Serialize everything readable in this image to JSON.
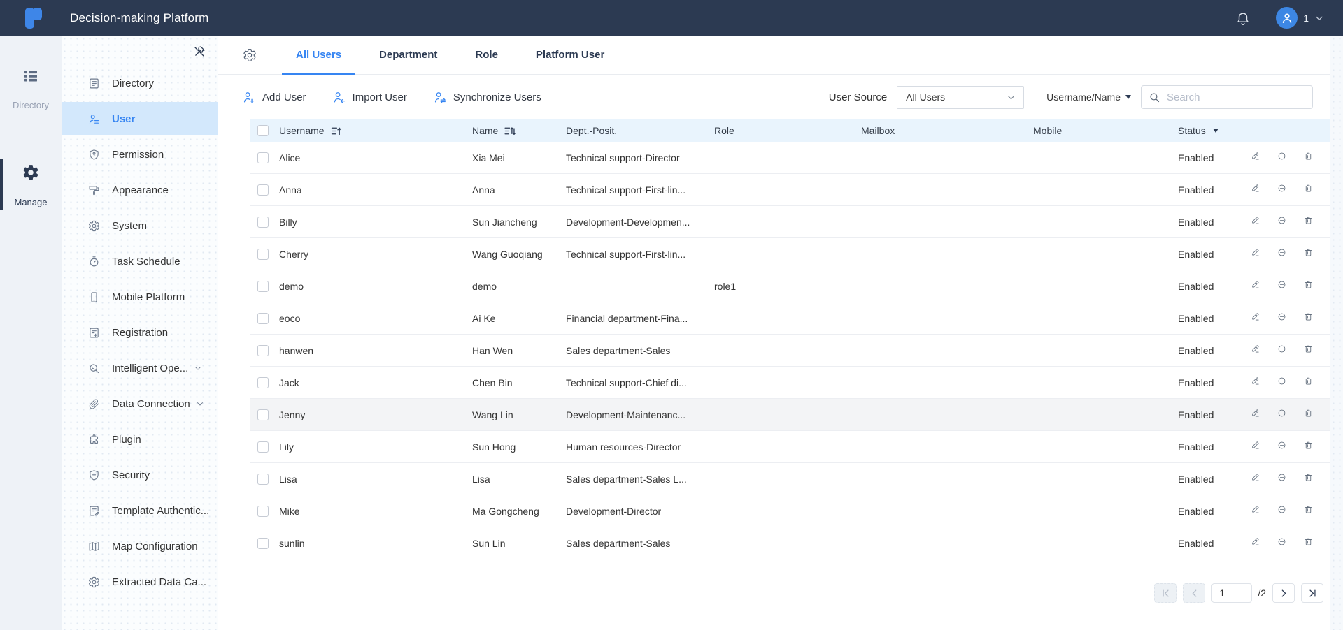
{
  "topbar": {
    "title": "Decision-making Platform",
    "notification_count": "1"
  },
  "rail": {
    "items": [
      {
        "label": "Directory",
        "icon": "directory-grid",
        "active": false
      },
      {
        "label": "Manage",
        "icon": "gear-filled",
        "active": true
      }
    ]
  },
  "sidebar": {
    "items": [
      {
        "label": "Directory",
        "icon": "directory-doc",
        "selected": false,
        "chevron": false
      },
      {
        "label": "User",
        "icon": "user-list",
        "selected": true,
        "chevron": false
      },
      {
        "label": "Permission",
        "icon": "shield-key",
        "selected": false,
        "chevron": false
      },
      {
        "label": "Appearance",
        "icon": "paint-roller",
        "selected": false,
        "chevron": false
      },
      {
        "label": "System",
        "icon": "gear-outline",
        "selected": false,
        "chevron": false
      },
      {
        "label": "Task Schedule",
        "icon": "stopwatch",
        "selected": false,
        "chevron": false
      },
      {
        "label": "Mobile Platform",
        "icon": "smartphone",
        "selected": false,
        "chevron": false
      },
      {
        "label": "Registration",
        "icon": "doc-plus",
        "selected": false,
        "chevron": false
      },
      {
        "label": "Intelligent Ope...",
        "icon": "magnifier-wrench",
        "selected": false,
        "chevron": true
      },
      {
        "label": "Data Connection",
        "icon": "paperclip",
        "selected": false,
        "chevron": true
      },
      {
        "label": "Plugin",
        "icon": "puzzle",
        "selected": false,
        "chevron": false
      },
      {
        "label": "Security",
        "icon": "shield-plus",
        "selected": false,
        "chevron": false
      },
      {
        "label": "Template Authentic...",
        "icon": "doc-pen",
        "selected": false,
        "chevron": false
      },
      {
        "label": "Map Configuration",
        "icon": "map",
        "selected": false,
        "chevron": false
      },
      {
        "label": "Extracted Data Ca...",
        "icon": "gear-outline",
        "selected": false,
        "chevron": false
      }
    ]
  },
  "tabs": [
    {
      "label": "All Users",
      "active": true
    },
    {
      "label": "Department",
      "active": false
    },
    {
      "label": "Role",
      "active": false
    },
    {
      "label": "Platform User",
      "active": false
    }
  ],
  "toolbar": {
    "actions": [
      {
        "label": "Add User",
        "icon": "add-user"
      },
      {
        "label": "Import User",
        "icon": "import-user"
      },
      {
        "label": "Synchronize Users",
        "icon": "sync-users"
      }
    ],
    "user_source_label": "User Source",
    "user_source_value": "All Users",
    "search_category": "Username/Name",
    "search_placeholder": "Search",
    "search_value": ""
  },
  "table": {
    "columns": {
      "username": "Username",
      "name": "Name",
      "dept": "Dept.-Posit.",
      "role": "Role",
      "mailbox": "Mailbox",
      "mobile": "Mobile",
      "status": "Status"
    },
    "rows": [
      {
        "username": "Alice",
        "name": "Xia Mei",
        "dept": "Technical support-Director",
        "role": "",
        "mailbox": "",
        "mobile": "",
        "status": "Enabled",
        "highlighted": false
      },
      {
        "username": "Anna",
        "name": "Anna",
        "dept": "Technical support-First-lin...",
        "role": "",
        "mailbox": "",
        "mobile": "",
        "status": "Enabled",
        "highlighted": false
      },
      {
        "username": "Billy",
        "name": "Sun Jiancheng",
        "dept": "Development-Developmen...",
        "role": "",
        "mailbox": "",
        "mobile": "",
        "status": "Enabled",
        "highlighted": false
      },
      {
        "username": "Cherry",
        "name": "Wang Guoqiang",
        "dept": "Technical support-First-lin...",
        "role": "",
        "mailbox": "",
        "mobile": "",
        "status": "Enabled",
        "highlighted": false
      },
      {
        "username": "demo",
        "name": "demo",
        "dept": "",
        "role": "role1",
        "mailbox": "",
        "mobile": "",
        "status": "Enabled",
        "highlighted": false
      },
      {
        "username": "eoco",
        "name": "Ai Ke",
        "dept": "Financial department-Fina...",
        "role": "",
        "mailbox": "",
        "mobile": "",
        "status": "Enabled",
        "highlighted": false
      },
      {
        "username": "hanwen",
        "name": "Han Wen",
        "dept": "Sales department-Sales",
        "role": "",
        "mailbox": "",
        "mobile": "",
        "status": "Enabled",
        "highlighted": false
      },
      {
        "username": "Jack",
        "name": "Chen Bin",
        "dept": "Technical support-Chief di...",
        "role": "",
        "mailbox": "",
        "mobile": "",
        "status": "Enabled",
        "highlighted": false
      },
      {
        "username": "Jenny",
        "name": "Wang Lin",
        "dept": "Development-Maintenanc...",
        "role": "",
        "mailbox": "",
        "mobile": "",
        "status": "Enabled",
        "highlighted": true
      },
      {
        "username": "Lily",
        "name": "Sun Hong",
        "dept": "Human resources-Director",
        "role": "",
        "mailbox": "",
        "mobile": "",
        "status": "Enabled",
        "highlighted": false
      },
      {
        "username": "Lisa",
        "name": "Lisa",
        "dept": "Sales department-Sales L...",
        "role": "",
        "mailbox": "",
        "mobile": "",
        "status": "Enabled",
        "highlighted": false
      },
      {
        "username": "Mike",
        "name": "Ma Gongcheng",
        "dept": "Development-Director",
        "role": "",
        "mailbox": "",
        "mobile": "",
        "status": "Enabled",
        "highlighted": false
      },
      {
        "username": "sunlin",
        "name": "Sun Lin",
        "dept": "Sales department-Sales",
        "role": "",
        "mailbox": "",
        "mobile": "",
        "status": "Enabled",
        "highlighted": false
      }
    ]
  },
  "pagination": {
    "page": "1",
    "page_total": "/2"
  },
  "colors": {
    "accent": "#3685f2",
    "topbar_bg": "#2c3a52",
    "table_header_bg": "#e9f4fd",
    "selected_item_bg": "#d3e8fc",
    "avatar_bg": "#3d87e4"
  }
}
